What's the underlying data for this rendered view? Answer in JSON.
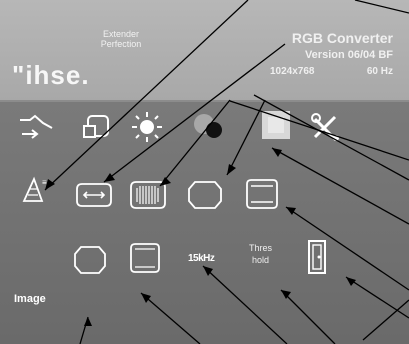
{
  "header": {
    "tagline": [
      "Extender",
      "Perfection"
    ],
    "logo": "\"ihse.",
    "product_title": "RGB Converter",
    "version": "Version 06/04 BF",
    "resolution": "1024x768",
    "frequency": "60 Hz"
  },
  "menu": {
    "row1": [
      "connect-icon",
      "window-icon",
      "brightness-icon",
      "contrast-icon",
      "color-icon",
      "settings-icon"
    ],
    "row2": [
      "sharpness-icon",
      "horizontal-position-icon",
      "horizontal-size-icon",
      "vertical-position-icon",
      "vertical-size-icon"
    ],
    "row3": [
      "horizontal-geometry-icon",
      "vertical-geometry-icon",
      "frequency-label",
      "threshold-label",
      "exit-icon"
    ],
    "frequency_label": "15kHz",
    "threshold_label": [
      "Thres",
      "hold"
    ],
    "section_label": "Image"
  },
  "colors": {
    "header_bg": "#b0b0b0",
    "panel_bg": "#727272",
    "icon_stroke": "#ffffff",
    "arrow_stroke": "#000000",
    "selected_bg": "#d8d8d8"
  }
}
